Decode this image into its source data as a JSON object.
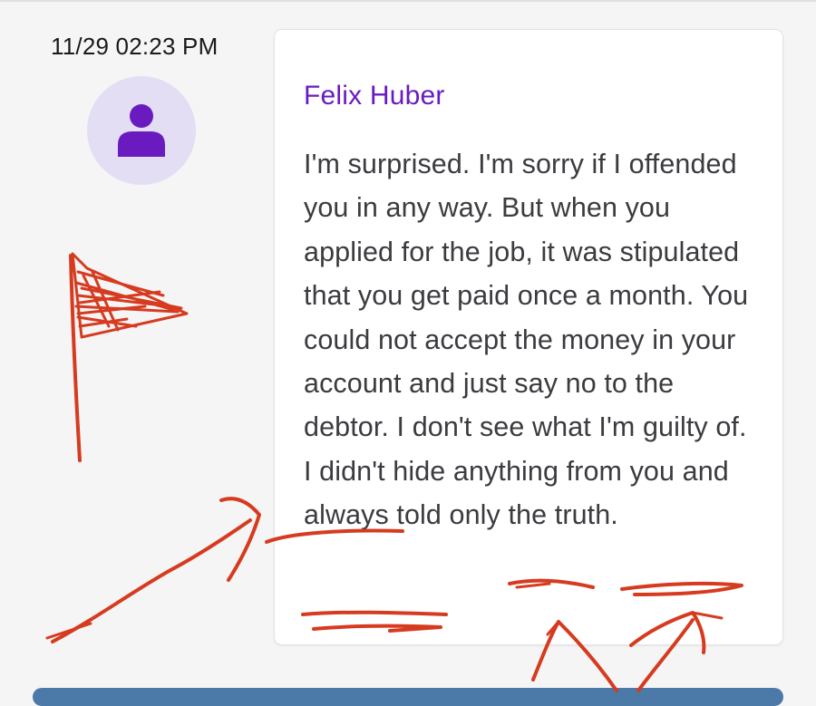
{
  "message": {
    "timestamp": "11/29 02:23 PM",
    "sender": "Felix Huber",
    "text": "I'm surprised. I'm sorry if I offended you in any way. But when you applied for the job, it was stipulated that you get paid once a month. You could not accept the money in your account and just say no to the debtor. I don't see what I'm guilty of. I didn't hide anything from you and always told only the truth."
  },
  "avatar": {
    "icon": "user-icon",
    "background": "#e3def3",
    "icon_color": "#6a1bc0"
  },
  "annotations": {
    "color": "#d63b1f",
    "items": [
      "red-flag-drawing",
      "arrow-drawing",
      "underline-drawings",
      "caret-drawings"
    ]
  },
  "colors": {
    "sender": "#6a1bc0",
    "text": "#3b3b40",
    "bottom_bar": "#4b79a8"
  }
}
